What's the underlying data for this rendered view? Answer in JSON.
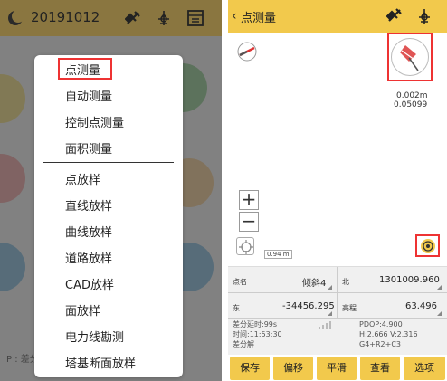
{
  "left": {
    "header": {
      "title": "20191012"
    },
    "menu": {
      "items": [
        "点测量",
        "自动测量",
        "控制点测量",
        "面积测量",
        "点放样",
        "直线放样",
        "曲线放样",
        "道路放样",
        "CAD放样",
        "面放样",
        "电力线勘测",
        "塔基断面放样"
      ]
    },
    "status_text": "P : 差分"
  },
  "right": {
    "header": {
      "title": "点测量"
    },
    "map": {
      "distance": "0.002m",
      "angle": "0.05099",
      "scale": "0.94 m"
    },
    "info": {
      "point_name_label": "点名",
      "point_name_value": "倾斜4",
      "north_label": "北",
      "north_value": "1301009.960",
      "east_label": "东",
      "east_value": "-34456.295",
      "elev_label": "高程",
      "elev_value": "63.496",
      "diff_delay": "差分延时:99s",
      "time": "时间:11:53:30",
      "solution": "差分解",
      "pdop": "PDOP:4.900",
      "hv": "H:2.666  V:2.316",
      "constellation": "G4+R2+C3"
    },
    "buttons": [
      "保存",
      "偏移",
      "平滑",
      "查看",
      "选项"
    ]
  },
  "colors": {
    "accent": "#f2c94c",
    "highlight": "#e33333"
  }
}
